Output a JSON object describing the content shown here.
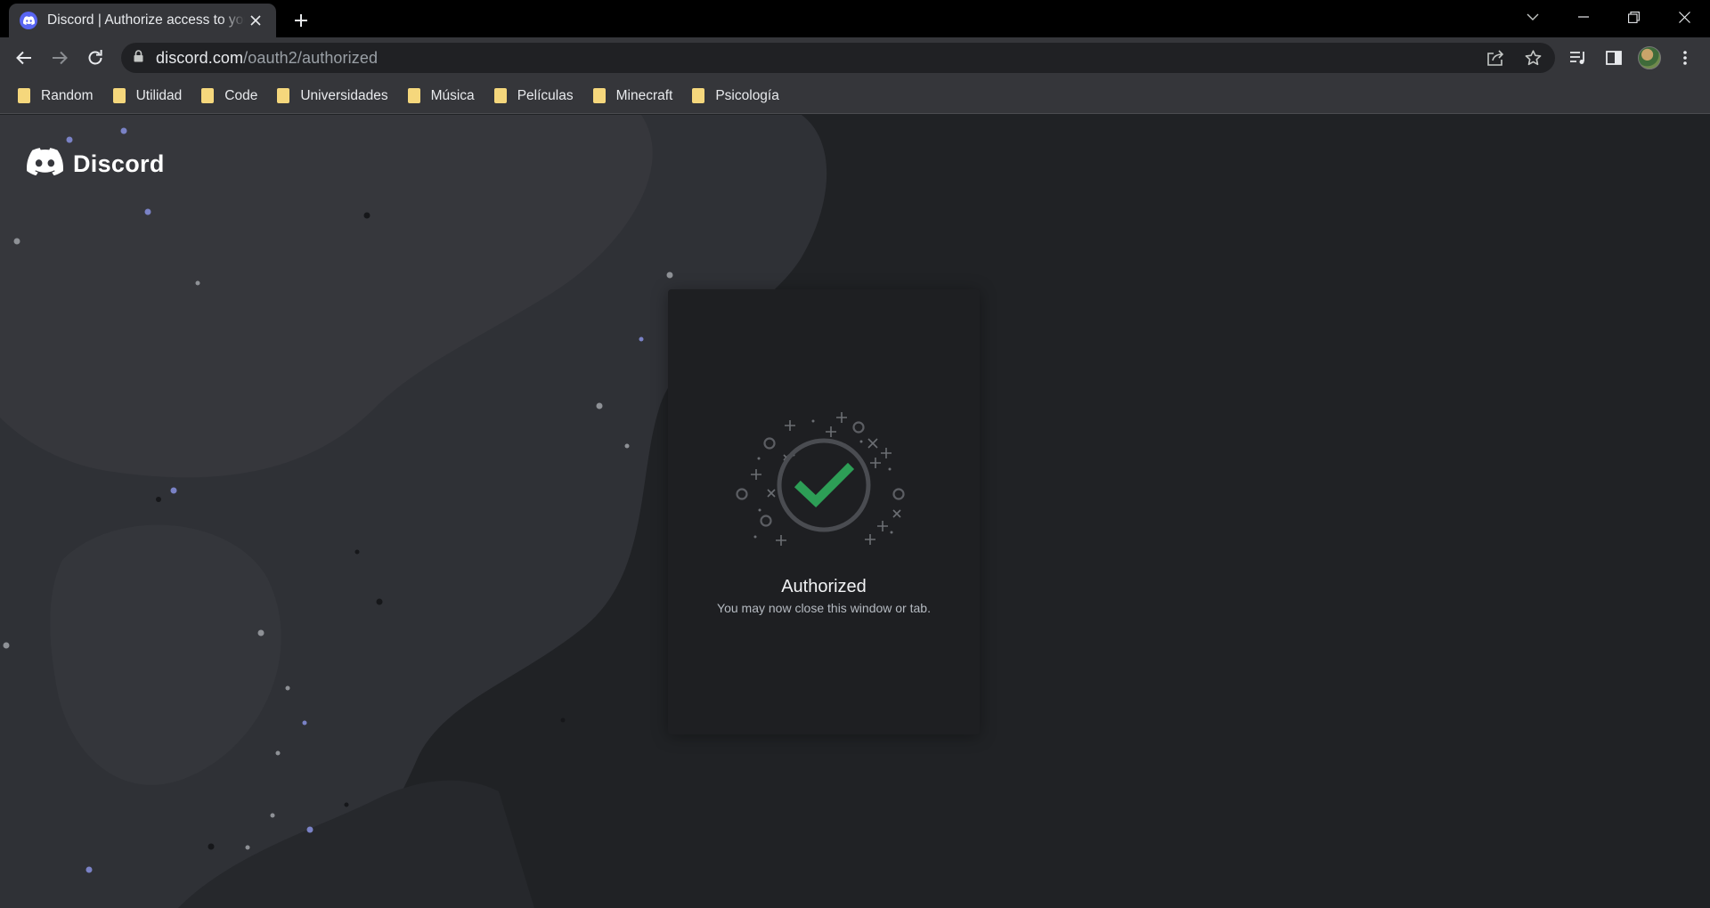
{
  "browser": {
    "tab": {
      "title": "Discord | Authorize access to your account"
    },
    "address_bar": {
      "host": "discord.com",
      "path": "/oauth2/authorized"
    },
    "bookmarks": [
      {
        "label": "Random"
      },
      {
        "label": "Utilidad"
      },
      {
        "label": "Code"
      },
      {
        "label": "Universidades"
      },
      {
        "label": "Música"
      },
      {
        "label": "Películas"
      },
      {
        "label": "Minecraft"
      },
      {
        "label": "Psicología"
      }
    ]
  },
  "page": {
    "brand": {
      "name": "Discord"
    },
    "card": {
      "title": "Authorized",
      "subtitle": "You may now close this window or tab."
    }
  },
  "colors": {
    "accent": "#5865f2",
    "success": "#2d9e56",
    "background": "#202225",
    "card": "#1e1f22"
  },
  "icons": {
    "favicon": "discord-logo-icon",
    "check": "check-icon"
  }
}
